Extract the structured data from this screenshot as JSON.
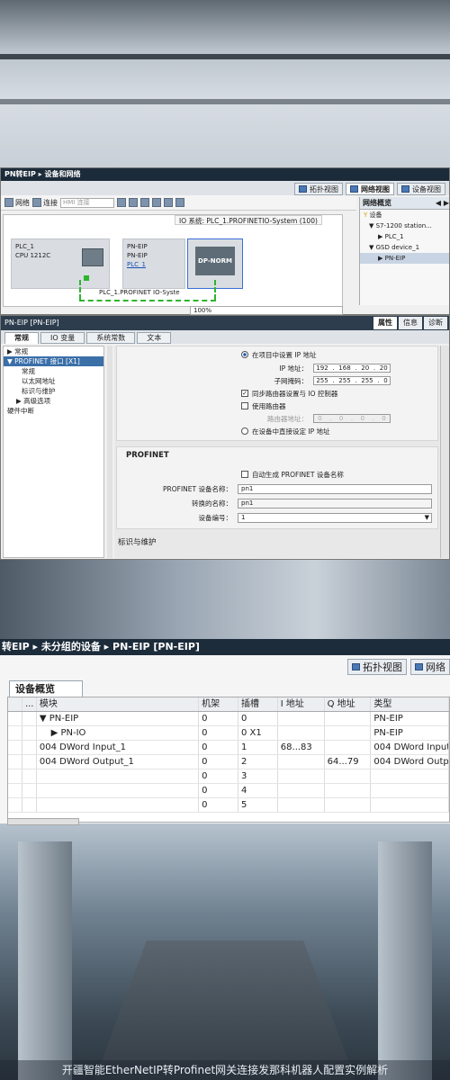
{
  "panel1": {
    "title": "PN转EIP ▸ 设备和网络",
    "view_tabs": [
      "拓扑视图",
      "网络视图",
      "设备视图"
    ],
    "toolbar": {
      "network_label": "网络",
      "connect_label": "连接",
      "hmi_placeholder": "HMI 连接"
    },
    "io_system": "IO 系统: PLC_1.PROFINETIO-System (100)",
    "plc": {
      "name": "PLC_1",
      "cpu": "CPU 1212C"
    },
    "pneip": {
      "name": "PN-EIP",
      "type": "PN-EIP",
      "link": "PLC_1"
    },
    "dpnorm_label": "DP-NORM",
    "network_label": "PLC_1.PROFINET IO-Syste",
    "zoom": "100%",
    "overview": {
      "tab": "网络概览",
      "rows": [
        "设备",
        "S7-1200 station...",
        "PLC_1",
        "GSD device_1",
        "PN-EIP"
      ]
    }
  },
  "panel2": {
    "title": "PN-EIP [PN-EIP]",
    "right_tabs": [
      "属性",
      "信息",
      "诊断"
    ],
    "sub_tabs": [
      "常规",
      "IO 变量",
      "系统常数",
      "文本"
    ],
    "tree": [
      "常规",
      "PROFINET 接口 [X1]",
      "常规",
      "以太网地址",
      "标识与维护",
      "高级选项",
      "硬件中断"
    ],
    "ip_mode_project": "在项目中设置 IP 地址",
    "ip_label": "IP 地址：",
    "ip": [
      "192",
      "168",
      "20",
      "20"
    ],
    "mask_label": "子网掩码：",
    "mask": [
      "255",
      "255",
      "255",
      "0"
    ],
    "sync_router": "同步路由器设置与 IO 控制器",
    "use_router": "使用路由器",
    "router_label": "路由器地址：",
    "router": [
      "0",
      "0",
      "0",
      "0"
    ],
    "ip_mode_device": "在设备中直接设定 IP 地址",
    "profinet_heading": "PROFINET",
    "auto_name": "自动生成 PROFINET 设备名称",
    "dev_name_label": "PROFINET 设备名称：",
    "dev_name": "pn1",
    "conv_name_label": "转换的名称：",
    "conv_name": "pn1",
    "dev_num_label": "设备编号：",
    "dev_num": "1",
    "next_section": "标识与维护"
  },
  "panel3": {
    "breadcrumb": "转EIP ▸ 未分组的设备 ▸ PN-EIP [PN-EIP]",
    "view_tabs": [
      "拓扑视图",
      "网络"
    ],
    "overview_tab": "设备概览",
    "headers": [
      "",
      "...",
      "模块",
      "机架",
      "插槽",
      "I 地址",
      "Q 地址",
      "类型"
    ],
    "rows": [
      [
        "",
        "",
        "▼ PN-EIP",
        "0",
        "0",
        "",
        "",
        "PN-EIP"
      ],
      [
        "",
        "",
        "    ▶ PN-IO",
        "0",
        "0 X1",
        "",
        "",
        "PN-EIP"
      ],
      [
        "",
        "",
        "004 DWord Input_1",
        "0",
        "1",
        "68...83",
        "",
        "004 DWord Input"
      ],
      [
        "",
        "",
        "004 DWord Output_1",
        "0",
        "2",
        "",
        "64...79",
        "004 DWord Output"
      ],
      [
        "",
        "",
        "",
        "0",
        "3",
        "",
        "",
        ""
      ],
      [
        "",
        "",
        "",
        "0",
        "4",
        "",
        "",
        ""
      ],
      [
        "",
        "",
        "",
        "0",
        "5",
        "",
        "",
        ""
      ]
    ]
  },
  "caption": "开疆智能EtherNetIP转Profinet网关连接发那科机器人配置实例解析",
  "colors": {
    "net_green": "#2cb52c",
    "title_dark": "#1d2c3b",
    "select_blue": "#3a6fd8"
  }
}
